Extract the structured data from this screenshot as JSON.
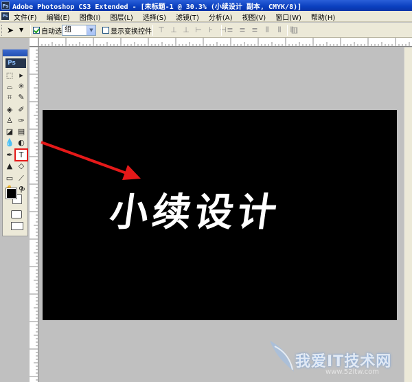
{
  "window": {
    "title": "Adobe Photoshop CS3 Extended - [未标题-1 @ 30.3% (小续设计 副本, CMYK/8)]",
    "app_icon": "Ps"
  },
  "menu": {
    "items": [
      "文件(F)",
      "编辑(E)",
      "图像(I)",
      "图层(L)",
      "选择(S)",
      "滤镜(T)",
      "分析(A)",
      "视图(V)",
      "窗口(W)",
      "帮助(H)"
    ]
  },
  "options": {
    "auto_select_label": "自动选择:",
    "auto_select_checked": true,
    "auto_select_value": "组",
    "show_transform_label": "显示变换控件",
    "show_transform_checked": false,
    "tool_icon": "move-tool-icon"
  },
  "toolbox": {
    "logo": "Ps",
    "selected_tool": "type-tool",
    "foreground_color": "#000000",
    "background_color": "#ffffff"
  },
  "document": {
    "text": "小续设计",
    "background": "#000000",
    "text_color": "#ffffff"
  },
  "annotation": {
    "arrow_color": "#e51919"
  },
  "watermark": {
    "text": "我爱IT技术网",
    "url": "www.52itw.com"
  }
}
